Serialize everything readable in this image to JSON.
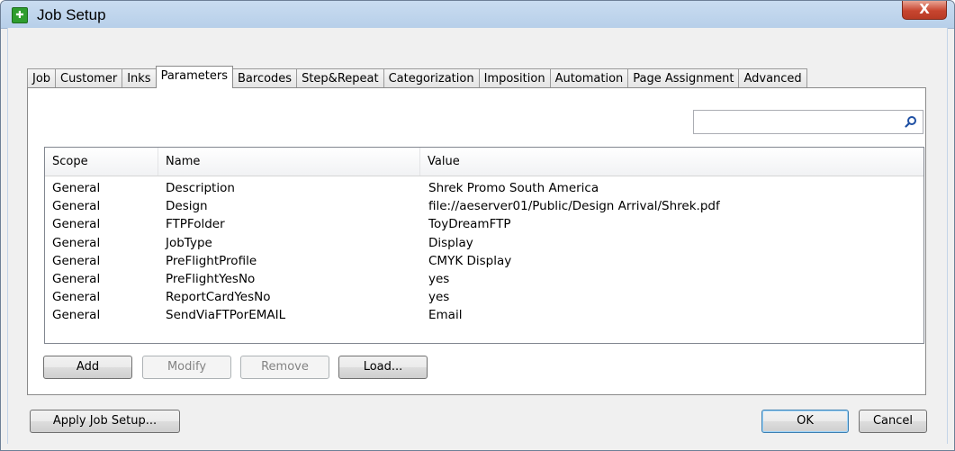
{
  "window": {
    "title": "Job Setup",
    "close_label": "X"
  },
  "tabs": [
    {
      "label": "Job"
    },
    {
      "label": "Customer"
    },
    {
      "label": "Inks"
    },
    {
      "label": "Parameters",
      "active": true
    },
    {
      "label": "Barcodes"
    },
    {
      "label": "Step&Repeat"
    },
    {
      "label": "Categorization"
    },
    {
      "label": "Imposition"
    },
    {
      "label": "Automation"
    },
    {
      "label": "Page Assignment"
    },
    {
      "label": "Advanced"
    }
  ],
  "search": {
    "value": "",
    "icon": "search-icon"
  },
  "table": {
    "columns": [
      "Scope",
      "Name",
      "Value"
    ],
    "rows": [
      [
        "General",
        "Description",
        "Shrek Promo South America"
      ],
      [
        "General",
        "Design",
        "file://aeserver01/Public/Design Arrival/Shrek.pdf"
      ],
      [
        "General",
        "FTPFolder",
        "ToyDreamFTP"
      ],
      [
        "General",
        "JobType",
        "Display"
      ],
      [
        "General",
        "PreFlightProfile",
        "CMYK Display"
      ],
      [
        "General",
        "PreFlightYesNo",
        "yes"
      ],
      [
        "General",
        "ReportCardYesNo",
        "yes"
      ],
      [
        "General",
        "SendViaFTPorEMAIL",
        "Email"
      ]
    ]
  },
  "buttons": {
    "add": "Add",
    "modify": "Modify",
    "remove": "Remove",
    "load": "Load...",
    "apply": "Apply Job Setup...",
    "ok": "OK",
    "cancel": "Cancel"
  }
}
